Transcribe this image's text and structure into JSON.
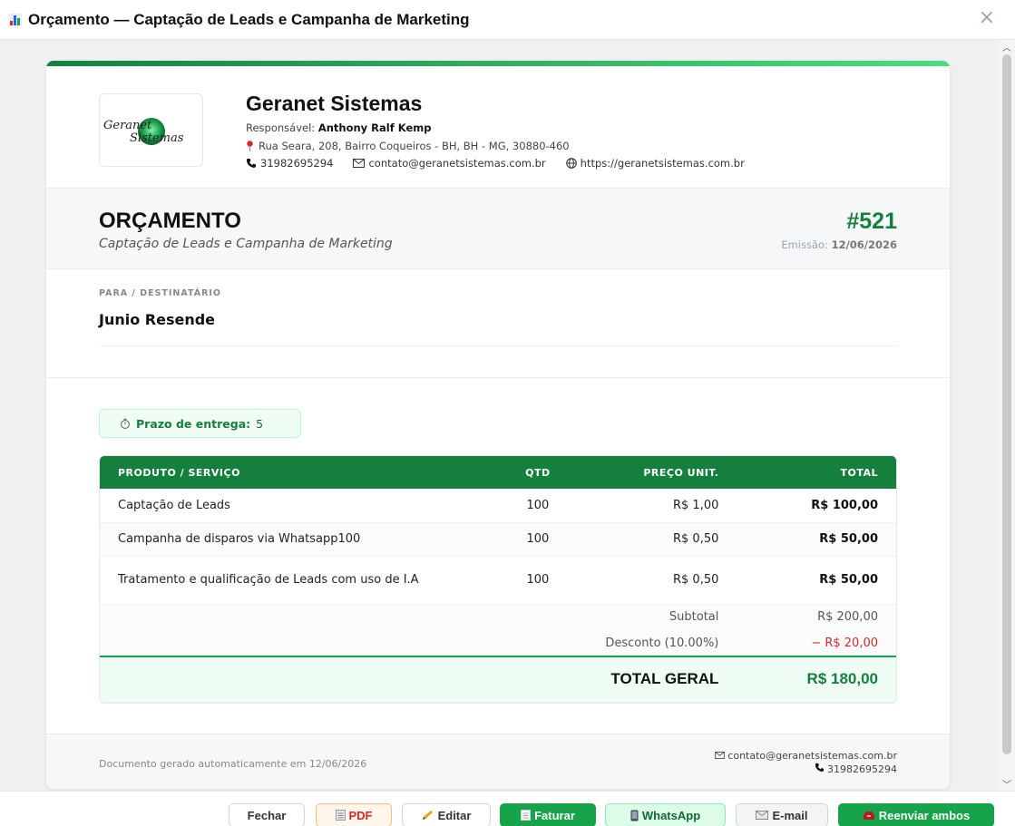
{
  "window": {
    "title": "Orçamento — Captação de Leads e Campanha de Marketing",
    "close_glyph": "×"
  },
  "company": {
    "name": "Geranet Sistemas",
    "logo_text_1": "Geranet",
    "logo_text_2": "Sistemas",
    "responsible_label": "Responsável:",
    "responsible_name": "Anthony Ralf Kemp",
    "address": "Rua Seara, 208, Bairro Coqueiros - BH, BH - MG, 30880-460",
    "phone": "31982695294",
    "email": "contato@geranetsistemas.com.br",
    "website": "https://geranetsistemas.com.br"
  },
  "document": {
    "title": "ORÇAMENTO",
    "subtitle": "Captação de Leads e Campanha de Marketing",
    "number": "#521",
    "emission_label": "Emissão:",
    "emission_date": "12/06/2026"
  },
  "recipient": {
    "label": "PARA / DESTINATÁRIO",
    "name": "Junio Resende"
  },
  "delivery": {
    "label": "Prazo de entrega:",
    "value": "5"
  },
  "table": {
    "headers": {
      "product": "PRODUTO / SERVIÇO",
      "qty": "QTD",
      "unit_price": "PREÇO UNIT.",
      "total": "TOTAL"
    },
    "rows": [
      {
        "product": "Captação de Leads",
        "qty": "100",
        "unit_price": "R$ 1,00",
        "total": "R$ 100,00"
      },
      {
        "product": "Campanha de disparos via Whatsapp100",
        "qty": "100",
        "unit_price": "R$ 0,50",
        "total": "R$ 50,00"
      },
      {
        "product": "Tratamento e qualificação de Leads com uso de I.A",
        "qty": "100",
        "unit_price": "R$ 0,50",
        "total": "R$ 50,00"
      }
    ],
    "subtotal_label": "Subtotal",
    "subtotal_value": "R$ 200,00",
    "discount_label": "Desconto (10.00%)",
    "discount_value": "− R$ 20,00",
    "grand_label": "TOTAL GERAL",
    "grand_value": "R$ 180,00"
  },
  "footer": {
    "generated": "Documento gerado automaticamente em 12/06/2026",
    "email": "contato@geranetsistemas.com.br",
    "phone": "31982695294"
  },
  "actions": {
    "fechar": "Fechar",
    "pdf": "PDF",
    "editar": "Editar",
    "faturar": "Faturar",
    "whatsapp": "WhatsApp",
    "email": "E-mail",
    "reenviar": "Reenviar ambos"
  },
  "colors": {
    "brand_green": "#15803d",
    "accent_light_green": "#4ade80",
    "discount_red": "#dc2626"
  }
}
